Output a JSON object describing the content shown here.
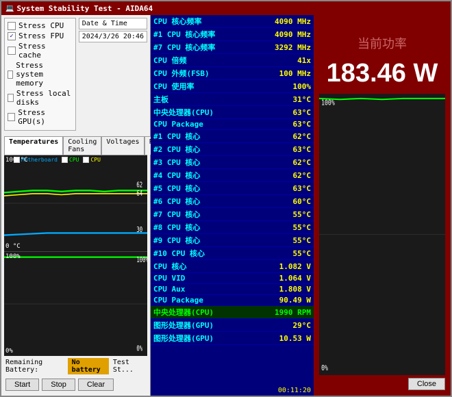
{
  "window": {
    "title": "System Stability Test - AIDA64"
  },
  "left_panel": {
    "stress_options": [
      {
        "label": "Stress CPU",
        "checked": false
      },
      {
        "label": "Stress FPU",
        "checked": true
      },
      {
        "label": "Stress cache",
        "checked": false
      },
      {
        "label": "Stress system memory",
        "checked": false
      },
      {
        "label": "Stress local disks",
        "checked": false
      },
      {
        "label": "Stress GPU(s)",
        "checked": false
      }
    ],
    "date_time_label": "Date & Time",
    "date_time_value": "2024/3/26 20:46",
    "tabs": [
      "Temperatures",
      "Cooling Fans",
      "Voltages",
      "Powers"
    ],
    "graph_labels": {
      "top1": "100 °C",
      "bottom1": "0 °C",
      "top2": "100%",
      "bottom2": "0%"
    },
    "legend": {
      "motherboard": "Motherboard",
      "cpu1": "CPU",
      "cpu2": "CPU"
    }
  },
  "data_rows": [
    {
      "label": "CPU 核心频率",
      "value": "4090 MHz"
    },
    {
      "label": "#1 CPU 核心频率",
      "value": "4090 MHz"
    },
    {
      "label": "#7 CPU 核心频率",
      "value": "3292 MHz"
    },
    {
      "label": "CPU 倍频",
      "value": "41x"
    },
    {
      "label": "CPU 外频(FSB)",
      "value": "100 MHz"
    },
    {
      "label": "CPU 使用率",
      "value": "100%"
    },
    {
      "label": "主板",
      "value": "31°C"
    },
    {
      "label": "中央处理器(CPU)",
      "value": "63°C"
    },
    {
      "label": "CPU Package",
      "value": "63°C"
    },
    {
      "label": "#1 CPU 核心",
      "value": "62°C"
    },
    {
      "label": "#2 CPU 核心",
      "value": "63°C"
    },
    {
      "label": "#3 CPU 核心",
      "value": "62°C"
    },
    {
      "label": "#4 CPU 核心",
      "value": "62°C"
    },
    {
      "label": "#5 CPU 核心",
      "value": "63°C"
    },
    {
      "label": "#6 CPU 核心",
      "value": "60°C"
    },
    {
      "label": "#7 CPU 核心",
      "value": "55°C"
    },
    {
      "label": "#8 CPU 核心",
      "value": "55°C"
    },
    {
      "label": "#9 CPU 核心",
      "value": "55°C"
    },
    {
      "label": "#10 CPU 核心",
      "value": "55°C"
    },
    {
      "label": "CPU 核心",
      "value": "1.082 V"
    },
    {
      "label": "CPU VID",
      "value": "1.064 V"
    },
    {
      "label": "CPU Aux",
      "value": "1.808 V"
    },
    {
      "label": "CPU Package",
      "value": "90.49 W"
    },
    {
      "label": "中央处理器(CPU)",
      "value": "1990 RPM",
      "highlight": true
    },
    {
      "label": "图形处理器(GPU)",
      "value": "29°C"
    },
    {
      "label": "图形处理器(GPU)",
      "value": "10.53 W"
    }
  ],
  "right_panel": {
    "power_label": "当前功率",
    "power_value": "183.46 W"
  },
  "bottom_bar": {
    "remaining_battery_label": "Remaining Battery:",
    "battery_value": "No battery",
    "test_st_label": "Test St...",
    "timer": "00:11:20",
    "buttons": {
      "start": "Start",
      "stop": "Stop",
      "clear": "Clear",
      "close": "Close"
    }
  }
}
